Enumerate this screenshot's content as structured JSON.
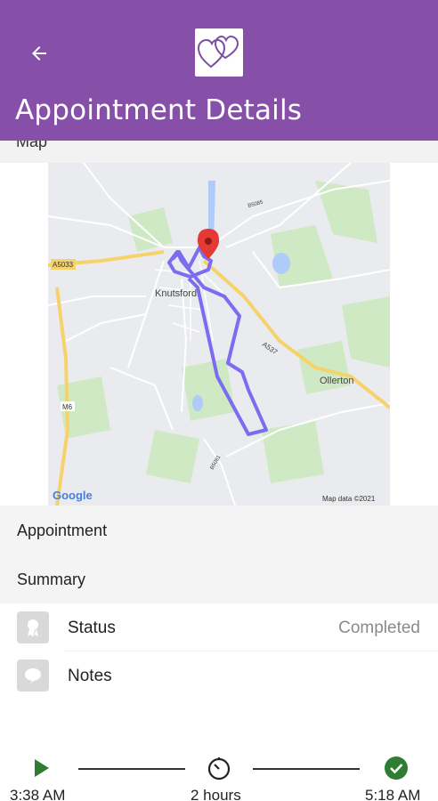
{
  "header": {
    "title": "Appointment Details",
    "back_icon": "arrow-left-icon",
    "logo_icon": "hearts-logo-icon",
    "bg_color": "#8650a8"
  },
  "map_section": {
    "label": "Map",
    "map_labels": {
      "town": "Knutsford",
      "village": "Ollerton",
      "road_a5033": "A5033",
      "road_a537": "A537",
      "road_m6": "M6",
      "road_b5085": "B5085",
      "road_b5081": "B5081",
      "google": "Google",
      "attribution": "Map data ©2021"
    },
    "route_color": "#7b6cf0",
    "pin_color": "#e53935"
  },
  "sections": {
    "appointment_label": "Appointment",
    "summary_label": "Summary"
  },
  "details": [
    {
      "icon": "award-ribbon-icon",
      "label": "Status",
      "value": "Completed"
    },
    {
      "icon": "speech-bubble-icon",
      "label": "Notes",
      "value": ""
    }
  ],
  "timeline": {
    "start_time": "3:38 AM",
    "duration": "2 hours",
    "end_time": "5:18 AM",
    "start_icon": "play-icon",
    "duration_icon": "timer-icon",
    "end_icon": "check-circle-icon",
    "play_color": "#2e7d32",
    "check_color": "#2e7d32"
  }
}
